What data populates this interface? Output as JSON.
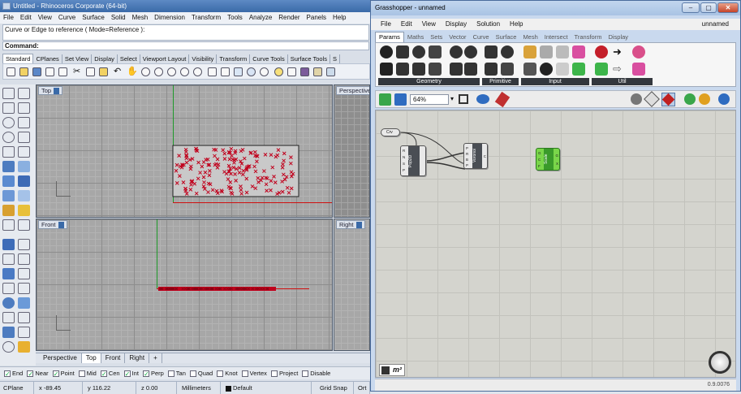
{
  "rhino": {
    "title": "Untitled - Rhinoceros Corporate (64-bit)",
    "menu": [
      "File",
      "Edit",
      "View",
      "Curve",
      "Surface",
      "Solid",
      "Mesh",
      "Dimension",
      "Transform",
      "Tools",
      "Analyze",
      "Render",
      "Panels",
      "Help"
    ],
    "command_history": "Curve or Edge to reference ( Mode=Reference ):",
    "command_prompt": "Command:",
    "toolbar_tabs": [
      "Standard",
      "CPlanes",
      "Set View",
      "Display",
      "Select",
      "Viewport Layout",
      "Visibility",
      "Transform",
      "Curve Tools",
      "Surface Tools",
      "S"
    ],
    "active_toolbar_tab": "Standard",
    "viewports": {
      "top": "Top",
      "perspective": "Perspective",
      "front": "Front",
      "right": "Right"
    },
    "viewport_tabs": [
      "Perspective",
      "Top",
      "Front",
      "Right",
      "+"
    ],
    "active_viewport_tab": "Top",
    "osnaps": [
      {
        "label": "End",
        "on": true
      },
      {
        "label": "Near",
        "on": true
      },
      {
        "label": "Point",
        "on": true
      },
      {
        "label": "Mid",
        "on": false
      },
      {
        "label": "Cen",
        "on": true
      },
      {
        "label": "Int",
        "on": true
      },
      {
        "label": "Perp",
        "on": true
      },
      {
        "label": "Tan",
        "on": false
      },
      {
        "label": "Quad",
        "on": false
      },
      {
        "label": "Knot",
        "on": false
      },
      {
        "label": "Vertex",
        "on": false
      },
      {
        "label": "Project",
        "on": false
      },
      {
        "label": "Disable",
        "on": false
      }
    ],
    "status": {
      "cplane": "CPlane",
      "x": "x -89.45",
      "y": "y 116.22",
      "z": "z 0.00",
      "units": "Millimeters",
      "layer": "Default",
      "grid_snap": "Grid Snap",
      "ortho": "Ort"
    },
    "colors": {
      "point_red": "#c0001c",
      "axis_green": "#1f9a2a",
      "axis_red": "#d01010"
    }
  },
  "grasshopper": {
    "title": "Grasshopper - unnamed",
    "menu": [
      "File",
      "Edit",
      "View",
      "Display",
      "Solution",
      "Help"
    ],
    "doc_name": "unnamed",
    "tabs": [
      "Params",
      "Maths",
      "Sets",
      "Vector",
      "Curve",
      "Surface",
      "Mesh",
      "Intersect",
      "Transform",
      "Display"
    ],
    "active_tab": "Params",
    "groups": [
      "Geometry",
      "Primitive",
      "Input",
      "Util"
    ],
    "zoom": "64%",
    "nodes": {
      "curve_param": "Crv",
      "populate": {
        "name": "Pop2D",
        "inputs": [
          "R",
          "N",
          "S",
          "P"
        ]
      },
      "voronoi": {
        "name": "Voronoi",
        "inputs": [
          "P",
          "R",
          "B",
          "P"
        ],
        "outputs": [
          "C"
        ]
      },
      "scale": {
        "name": "Scale",
        "inputs": [
          "G",
          "C",
          "F"
        ],
        "outputs": [
          "G",
          "X"
        ]
      }
    },
    "version": "0.9.0076",
    "node_label_m2": "m²"
  }
}
